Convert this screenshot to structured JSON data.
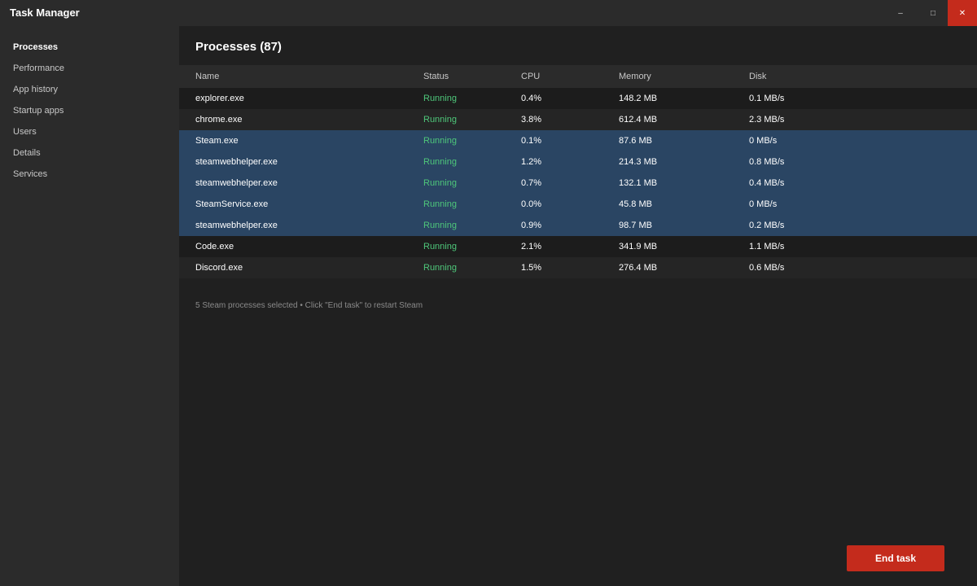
{
  "window": {
    "title": "Task Manager",
    "minimize_icon": "–",
    "maximize_icon": "□",
    "close_icon": "✕"
  },
  "sidebar": {
    "items": [
      {
        "label": "Processes",
        "active": true
      },
      {
        "label": "Performance",
        "active": false
      },
      {
        "label": "App history",
        "active": false
      },
      {
        "label": "Startup apps",
        "active": false
      },
      {
        "label": "Users",
        "active": false
      },
      {
        "label": "Details",
        "active": false
      },
      {
        "label": "Services",
        "active": false
      }
    ]
  },
  "main": {
    "title": "Processes",
    "count": "(87)",
    "columns": {
      "name": "Name",
      "status": "Status",
      "cpu": "CPU",
      "memory": "Memory",
      "disk": "Disk"
    },
    "rows": [
      {
        "name": "explorer.exe",
        "status": "Running",
        "cpu": "0.4%",
        "memory": "148.2 MB",
        "disk": "0.1 MB/s",
        "selected": false
      },
      {
        "name": "chrome.exe",
        "status": "Running",
        "cpu": "3.8%",
        "memory": "612.4 MB",
        "disk": "2.3 MB/s",
        "selected": false
      },
      {
        "name": "Steam.exe",
        "status": "Running",
        "cpu": "0.1%",
        "memory": "87.6 MB",
        "disk": "0 MB/s",
        "selected": true
      },
      {
        "name": "steamwebhelper.exe",
        "status": "Running",
        "cpu": "1.2%",
        "memory": "214.3 MB",
        "disk": "0.8 MB/s",
        "selected": true
      },
      {
        "name": "steamwebhelper.exe",
        "status": "Running",
        "cpu": "0.7%",
        "memory": "132.1 MB",
        "disk": "0.4 MB/s",
        "selected": true
      },
      {
        "name": "SteamService.exe",
        "status": "Running",
        "cpu": "0.0%",
        "memory": "45.8 MB",
        "disk": "0 MB/s",
        "selected": true
      },
      {
        "name": "steamwebhelper.exe",
        "status": "Running",
        "cpu": "0.9%",
        "memory": "98.7 MB",
        "disk": "0.2 MB/s",
        "selected": true
      },
      {
        "name": "Code.exe",
        "status": "Running",
        "cpu": "2.1%",
        "memory": "341.9 MB",
        "disk": "1.1 MB/s",
        "selected": false
      },
      {
        "name": "Discord.exe",
        "status": "Running",
        "cpu": "1.5%",
        "memory": "276.4 MB",
        "disk": "0.6 MB/s",
        "selected": false
      }
    ],
    "hint": "5 Steam processes selected • Click \"End task\" to restart Steam",
    "end_task_label": "End task"
  },
  "colors": {
    "accent_red": "#c42b1c",
    "selected_row": "#2a4563",
    "status_green": "#4ec77a"
  }
}
